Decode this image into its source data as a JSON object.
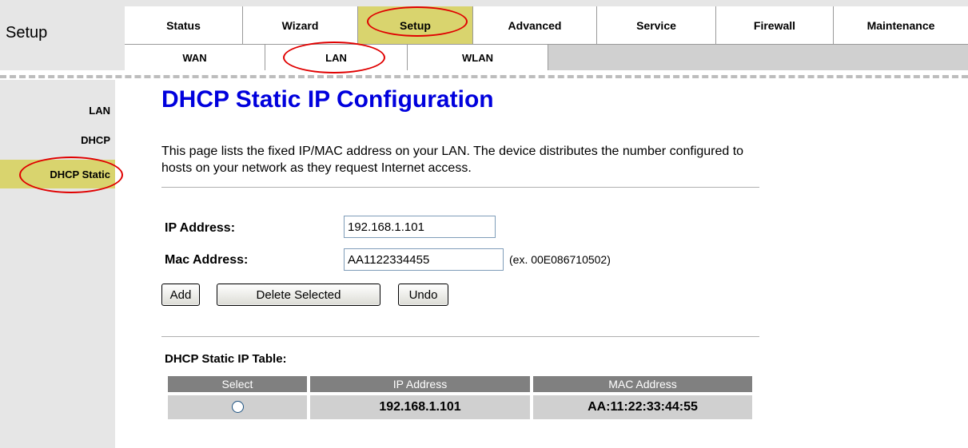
{
  "header": {
    "section_label": "Setup",
    "main_tabs": [
      {
        "label": "Status"
      },
      {
        "label": "Wizard"
      },
      {
        "label": "Setup"
      },
      {
        "label": "Advanced"
      },
      {
        "label": "Service"
      },
      {
        "label": "Firewall"
      },
      {
        "label": "Maintenance"
      }
    ],
    "active_main_tab": "Setup",
    "sub_tabs": [
      {
        "label": "WAN"
      },
      {
        "label": "LAN"
      },
      {
        "label": "WLAN"
      }
    ],
    "active_sub_tab": "LAN"
  },
  "sidebar": {
    "items": [
      {
        "label": "LAN"
      },
      {
        "label": "DHCP"
      },
      {
        "label": "DHCP Static"
      }
    ],
    "active_item": "DHCP Static"
  },
  "main": {
    "title": "DHCP Static IP Configuration",
    "description": "This page lists the fixed IP/MAC address on your LAN. The device distributes the number configured to hosts on your network as they request Internet access.",
    "form": {
      "ip_label": "IP Address:",
      "ip_value": "192.168.1.101",
      "mac_label": "Mac Address:",
      "mac_value": "AA1122334455",
      "mac_hint": "(ex. 00E086710502)"
    },
    "buttons": {
      "add": "Add",
      "delete_selected": "Delete Selected",
      "undo": "Undo"
    },
    "table": {
      "title": "DHCP Static IP Table:",
      "columns": [
        "Select",
        "IP Address",
        "MAC Address"
      ],
      "rows": [
        {
          "selected": false,
          "ip": "192.168.1.101",
          "mac": "AA:11:22:33:44:55"
        }
      ]
    }
  },
  "colors": {
    "active_tab": "#d9d46e",
    "title": "#0000dd",
    "annotation": "#e00000",
    "table_header": "#808080",
    "table_cell": "#d0d0d0"
  },
  "icons": {
    "row_select": "radio-icon"
  }
}
